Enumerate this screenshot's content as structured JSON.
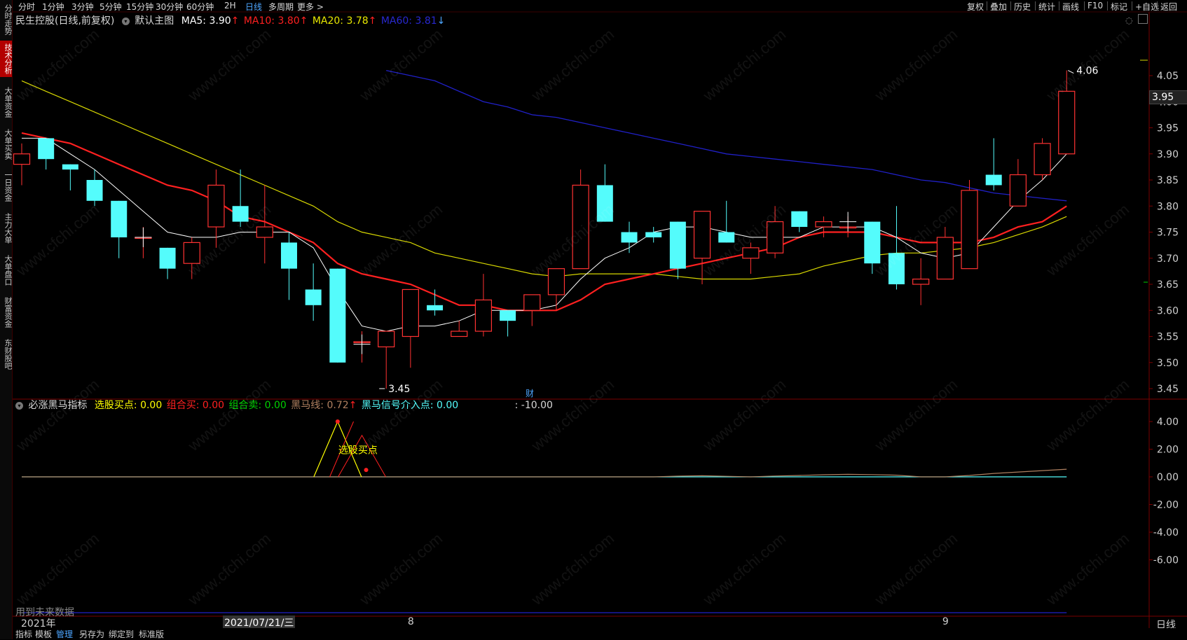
{
  "sidebar": {
    "items": [
      {
        "label": "分时走势",
        "active": false,
        "top": 2,
        "h": 52
      },
      {
        "label": "技术分析",
        "active": true,
        "top": 58,
        "h": 52
      },
      {
        "label": "大单资金",
        "active": false,
        "top": 120,
        "h": 52
      },
      {
        "label": "大单买卖",
        "active": false,
        "top": 180,
        "h": 52
      },
      {
        "label": "一日资金",
        "active": false,
        "top": 240,
        "h": 52
      },
      {
        "label": "主力大单",
        "active": false,
        "top": 300,
        "h": 52
      },
      {
        "label": "大单盘口",
        "active": false,
        "top": 360,
        "h": 52
      },
      {
        "label": "财富资金",
        "active": false,
        "top": 420,
        "h": 52
      },
      {
        "label": "东财股吧",
        "active": false,
        "top": 480,
        "h": 52
      }
    ]
  },
  "topbar": {
    "periods": [
      "分时",
      "1分钟",
      "3分钟",
      "5分钟",
      "15分钟",
      "30分钟",
      "60分钟",
      "2H",
      "日线",
      "多周期",
      "更多 >"
    ],
    "active_period": "日线",
    "right_tools": [
      "复权",
      "叠加",
      "历史",
      "统计",
      "画线",
      "F10",
      "标记",
      "+自选",
      "返回"
    ]
  },
  "main_legend": {
    "title": "民生控股(日线,前复权)",
    "template": "默认主图",
    "ma5": "MA5: 3.90",
    "ma10": "MA10: 3.80",
    "ma10_arrow": "↑",
    "ma20": "MA20: 3.78",
    "ma20_arrow": "↑",
    "ma60": "MA60: 3.81",
    "ma60_arrow": "↓"
  },
  "sub_legend": {
    "title": "必涨黑马指标",
    "xg": "选股买点: 0.00",
    "zhm": "组合买: 0.00",
    "zhs": "组合卖: 0.00",
    "hmx": "黑马线: 0.72",
    "hmx_arrow": "↑",
    "hmxh": "黑马信号介入点: 0.00",
    "extra": ": -10.00"
  },
  "annotations": {
    "high_label": "4.06",
    "low_label": "3.45",
    "cai_marker": "财",
    "sub_signal_label": "选股买点",
    "future_warning": "用到未来数据",
    "current_price": "3.95"
  },
  "x_axis": {
    "left_label": "2021年",
    "cursor_label": "2021/07/21/三",
    "month_labels": [
      {
        "text": "8",
        "i": 16
      },
      {
        "text": "9",
        "i": 38
      }
    ],
    "period_label": "日线"
  },
  "bottombar": {
    "items": [
      "指标",
      "模板",
      "管理",
      "另存为",
      "绑定到",
      "标准版"
    ],
    "active": "管理"
  },
  "watermark": "www.cfchi.com",
  "colors": {
    "up": "#ff3232",
    "down": "#54fcfc",
    "ma5": "#ffffff",
    "ma10": "#ff2020",
    "ma20": "#d8d800",
    "ma60": "#2020c8",
    "xg": "#ffff00",
    "zhm": "#ff2020",
    "zhs": "#00d000",
    "hmx": "#b08060",
    "hmxh": "#54fcfc"
  },
  "chart_data": {
    "type": "candlestick",
    "main": {
      "ylim": [
        3.42,
        4.1
      ],
      "yticks": [
        "4.05",
        "4.00",
        "3.95",
        "3.90",
        "3.85",
        "3.80",
        "3.75",
        "3.70",
        "3.65",
        "3.60",
        "3.55",
        "3.50",
        "3.45"
      ],
      "candles": [
        {
          "o": 3.88,
          "h": 3.92,
          "l": 3.84,
          "c": 3.9
        },
        {
          "o": 3.93,
          "h": 3.93,
          "l": 3.87,
          "c": 3.89
        },
        {
          "o": 3.88,
          "h": 3.88,
          "l": 3.83,
          "c": 3.87
        },
        {
          "o": 3.85,
          "h": 3.87,
          "l": 3.8,
          "c": 3.81
        },
        {
          "o": 3.81,
          "h": 3.81,
          "l": 3.7,
          "c": 3.74
        },
        {
          "o": 3.74,
          "h": 3.76,
          "l": 3.7,
          "c": 3.74
        },
        {
          "o": 3.72,
          "h": 3.72,
          "l": 3.66,
          "c": 3.68
        },
        {
          "o": 3.69,
          "h": 3.74,
          "l": 3.66,
          "c": 3.73
        },
        {
          "o": 3.76,
          "h": 3.87,
          "l": 3.72,
          "c": 3.84
        },
        {
          "o": 3.8,
          "h": 3.87,
          "l": 3.76,
          "c": 3.77
        },
        {
          "o": 3.74,
          "h": 3.84,
          "l": 3.69,
          "c": 3.76
        },
        {
          "o": 3.73,
          "h": 3.75,
          "l": 3.62,
          "c": 3.68
        },
        {
          "o": 3.64,
          "h": 3.69,
          "l": 3.58,
          "c": 3.61
        },
        {
          "o": 3.68,
          "h": 3.68,
          "l": 3.5,
          "c": 3.5
        },
        {
          "o": 3.54,
          "h": 3.56,
          "l": 3.5,
          "c": 3.54
        },
        {
          "o": 3.53,
          "h": 3.56,
          "l": 3.45,
          "c": 3.56
        },
        {
          "o": 3.55,
          "h": 3.63,
          "l": 3.49,
          "c": 3.64
        },
        {
          "o": 3.61,
          "h": 3.64,
          "l": 3.59,
          "c": 3.6
        },
        {
          "o": 3.55,
          "h": 3.58,
          "l": 3.55,
          "c": 3.56
        },
        {
          "o": 3.56,
          "h": 3.67,
          "l": 3.55,
          "c": 3.62
        },
        {
          "o": 3.6,
          "h": 3.6,
          "l": 3.55,
          "c": 3.58
        },
        {
          "o": 3.6,
          "h": 3.63,
          "l": 3.57,
          "c": 3.63
        },
        {
          "o": 3.63,
          "h": 3.68,
          "l": 3.6,
          "c": 3.68
        },
        {
          "o": 3.68,
          "h": 3.87,
          "l": 3.68,
          "c": 3.84
        },
        {
          "o": 3.84,
          "h": 3.88,
          "l": 3.77,
          "c": 3.77
        },
        {
          "o": 3.75,
          "h": 3.77,
          "l": 3.71,
          "c": 3.73
        },
        {
          "o": 3.75,
          "h": 3.76,
          "l": 3.73,
          "c": 3.74
        },
        {
          "o": 3.77,
          "h": 3.77,
          "l": 3.66,
          "c": 3.68
        },
        {
          "o": 3.7,
          "h": 3.79,
          "l": 3.65,
          "c": 3.79
        },
        {
          "o": 3.75,
          "h": 3.81,
          "l": 3.73,
          "c": 3.73
        },
        {
          "o": 3.7,
          "h": 3.73,
          "l": 3.67,
          "c": 3.72
        },
        {
          "o": 3.71,
          "h": 3.8,
          "l": 3.7,
          "c": 3.77
        },
        {
          "o": 3.79,
          "h": 3.79,
          "l": 3.75,
          "c": 3.76
        },
        {
          "o": 3.76,
          "h": 3.78,
          "l": 3.74,
          "c": 3.77
        },
        {
          "o": 3.76,
          "h": 3.78,
          "l": 3.74,
          "c": 3.76
        },
        {
          "o": 3.77,
          "h": 3.77,
          "l": 3.67,
          "c": 3.69
        },
        {
          "o": 3.71,
          "h": 3.8,
          "l": 3.64,
          "c": 3.65
        },
        {
          "o": 3.65,
          "h": 3.7,
          "l": 3.61,
          "c": 3.66
        },
        {
          "o": 3.66,
          "h": 3.76,
          "l": 3.66,
          "c": 3.74
        },
        {
          "o": 3.68,
          "h": 3.85,
          "l": 3.7,
          "c": 3.83
        },
        {
          "o": 3.86,
          "h": 3.93,
          "l": 3.83,
          "c": 3.84
        },
        {
          "o": 3.8,
          "h": 3.89,
          "l": 3.8,
          "c": 3.86
        },
        {
          "o": 3.86,
          "h": 3.93,
          "l": 3.85,
          "c": 3.92
        },
        {
          "o": 3.9,
          "h": 4.06,
          "l": 3.9,
          "c": 4.02
        }
      ],
      "ma5": [
        3.93,
        3.93,
        3.9,
        3.87,
        3.83,
        3.79,
        3.75,
        3.74,
        3.74,
        3.75,
        3.75,
        3.75,
        3.72,
        3.64,
        3.57,
        3.56,
        3.57,
        3.57,
        3.58,
        3.6,
        3.6,
        3.6,
        3.61,
        3.66,
        3.7,
        3.72,
        3.75,
        3.76,
        3.76,
        3.75,
        3.74,
        3.74,
        3.74,
        3.76,
        3.76,
        3.76,
        3.74,
        3.71,
        3.7,
        3.71,
        3.76,
        3.81,
        3.85,
        3.9
      ],
      "ma10": [
        3.94,
        3.93,
        3.92,
        3.9,
        3.88,
        3.86,
        3.84,
        3.83,
        3.81,
        3.78,
        3.77,
        3.75,
        3.73,
        3.69,
        3.67,
        3.66,
        3.65,
        3.63,
        3.61,
        3.61,
        3.6,
        3.6,
        3.6,
        3.62,
        3.65,
        3.66,
        3.67,
        3.68,
        3.69,
        3.7,
        3.71,
        3.72,
        3.74,
        3.75,
        3.75,
        3.75,
        3.74,
        3.73,
        3.73,
        3.73,
        3.74,
        3.76,
        3.77,
        3.8
      ],
      "ma20": [
        4.04,
        4.02,
        4.0,
        3.98,
        3.96,
        3.94,
        3.92,
        3.9,
        3.88,
        3.86,
        3.84,
        3.82,
        3.8,
        3.77,
        3.75,
        3.74,
        3.73,
        3.71,
        3.7,
        3.69,
        3.68,
        3.67,
        3.665,
        3.67,
        3.67,
        3.67,
        3.67,
        3.665,
        3.66,
        3.66,
        3.66,
        3.665,
        3.67,
        3.685,
        3.695,
        3.705,
        3.71,
        3.71,
        3.715,
        3.72,
        3.73,
        3.745,
        3.76,
        3.78
      ],
      "ma60_start_index": 15,
      "ma60": [
        4.06,
        4.05,
        4.04,
        4.02,
        4.0,
        3.99,
        3.975,
        3.97,
        3.96,
        3.95,
        3.94,
        3.93,
        3.92,
        3.91,
        3.9,
        3.895,
        3.89,
        3.885,
        3.88,
        3.875,
        3.87,
        3.86,
        3.85,
        3.845,
        3.835,
        3.825,
        3.82,
        3.815,
        3.81
      ]
    },
    "sub": {
      "ylim": [
        -8.0,
        5.0
      ],
      "yticks": [
        "4.00",
        "2.00",
        "0.00",
        "-2.00",
        "-4.00",
        "-6.00"
      ],
      "hmx": [
        0,
        0,
        0,
        0,
        0,
        0,
        0,
        0,
        0,
        0,
        0,
        0,
        0,
        0,
        0,
        0,
        0,
        0,
        0,
        0,
        0,
        0,
        0,
        0,
        0,
        0,
        0,
        0.05,
        0.08,
        0.04,
        0,
        0.06,
        0.1,
        0.15,
        0.18,
        0.16,
        0.12,
        0,
        0,
        0.1,
        0.25,
        0.35,
        0.45,
        0.55
      ],
      "xg_signal": [
        {
          "i": 13,
          "peak": 4.0
        }
      ],
      "zh_signal": [
        {
          "i": 14,
          "peak": 3.0
        }
      ],
      "dot": {
        "i": 14,
        "v": 0.5
      }
    }
  }
}
